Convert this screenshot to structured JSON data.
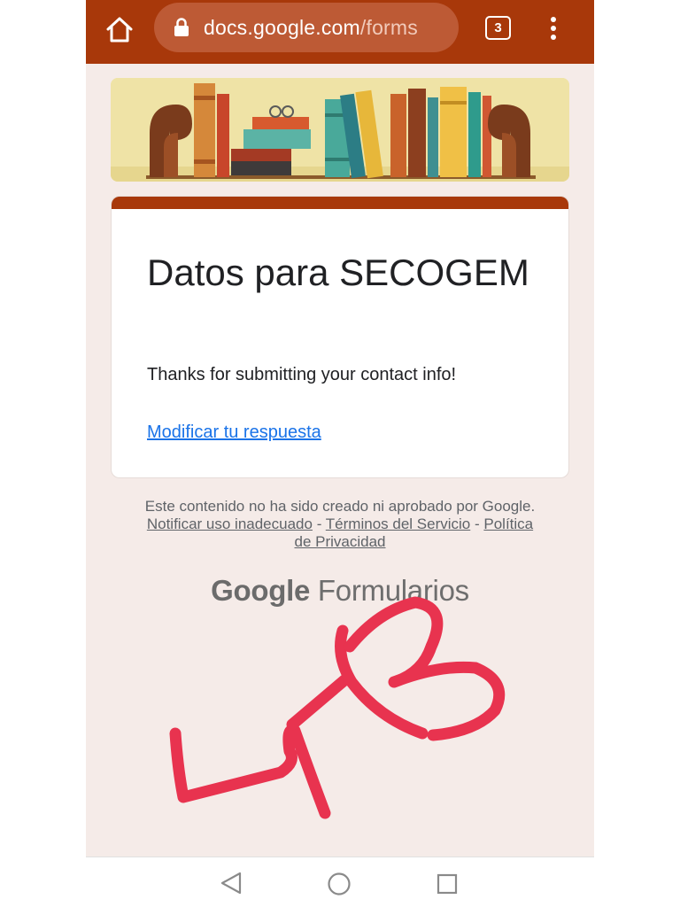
{
  "browser": {
    "url_domain": "docs.google.com",
    "url_path": "/forms",
    "tab_count": "3",
    "icons": {
      "home": "home-icon",
      "lock": "lock-icon",
      "menu": "more-vert-icon"
    }
  },
  "form": {
    "title": "Datos para SECOGEM",
    "confirmation_message": "Thanks for submitting your contact info!",
    "edit_response_link": "Modificar tu respuesta"
  },
  "footer": {
    "disclaimer_prefix": "Este contenido no ha sido creado ni aprobado por Google.",
    "report_abuse_link": "Notificar uso inadecuado",
    "separator": "-",
    "terms_link": "Términos del Servicio",
    "privacy_link": "Política de Privacidad",
    "brand_google": "Google",
    "brand_product": "Formularios"
  },
  "handwriting": {
    "text": "4-B",
    "color": "#e8334f"
  },
  "navbar": {
    "icons": [
      "back-triangle-icon",
      "home-circle-icon",
      "recent-apps-square-icon"
    ]
  },
  "colors": {
    "theme": "#a8380a",
    "url_bar": "#bd5a35",
    "page_background": "#f5ebe8",
    "link": "#1a73e8"
  }
}
